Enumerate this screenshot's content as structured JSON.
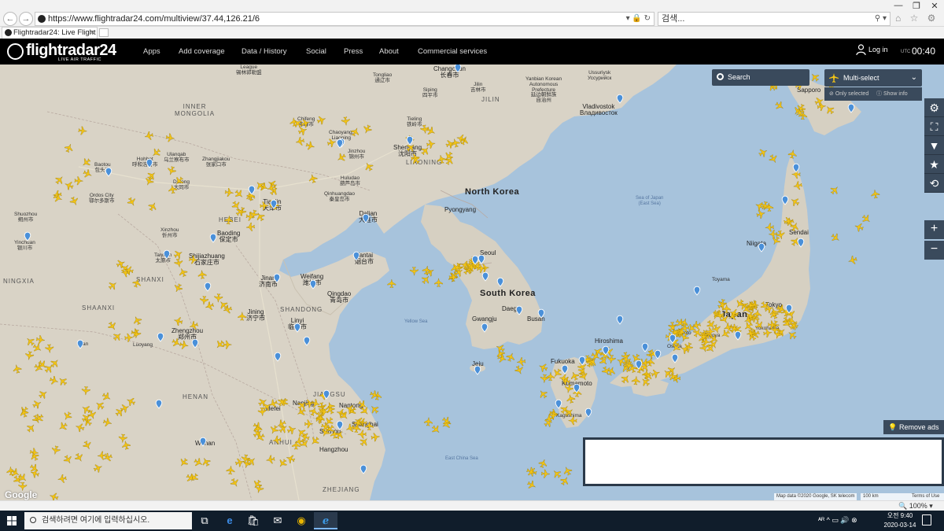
{
  "browser": {
    "url": "https://www.flightradar24.com/multiview/37.44,126.21/6",
    "search_placeholder": "검색...",
    "tab_title": "Flightradar24: Live Flight T...",
    "tab_close": "×",
    "back": "←",
    "forward": "→",
    "addr_tools": "▾ 🔒 ↻",
    "search_icon": "⚲ ▾",
    "toolbar_icons": "⌂ ☆ ⚙ ☺",
    "window_minimize": "—",
    "window_restore": "❐",
    "window_close": "✕"
  },
  "header": {
    "logo": "flightradar24",
    "logo_sub": "LIVE AIR TRAFFIC",
    "menu": [
      "Apps",
      "Add coverage",
      "Data / History",
      "Social",
      "Press",
      "About",
      "Commercial services"
    ],
    "login": "Log in",
    "utc_label": "UTC",
    "utc_time": "00:40"
  },
  "map": {
    "search_label": "Search",
    "multi_select_label": "Multi-select",
    "multi_select_chevron": "⌄",
    "only_selected": "Only selected",
    "show_info": "Show info",
    "side_tools": [
      {
        "name": "settings-icon",
        "glyph": "⚙"
      },
      {
        "name": "fullscreen-icon",
        "glyph": "⛶"
      },
      {
        "name": "filter-icon",
        "glyph": "▼"
      },
      {
        "name": "star-icon",
        "glyph": "★"
      },
      {
        "name": "playback-icon",
        "glyph": "⟲"
      }
    ],
    "zoom_in": "+",
    "zoom_out": "−",
    "remove_ads": "Remove ads",
    "google": "Google",
    "attribution": "Map data ©2020 Google, SK telecom",
    "scale": "100 km",
    "terms": "Terms of Use",
    "countries": {
      "north_korea": "North Korea",
      "south_korea": "South Korea",
      "japan": "Japan"
    },
    "regions": {
      "inner_mongolia": "INNER\nMONGOLIA",
      "jilin": "JILIN",
      "liaoning": "LIAONING",
      "hebei": "HEBEI",
      "shanxi": "SHANXI",
      "shaanxi": "SHAANXI",
      "ningxia": "NINGXIA",
      "shandong": "SHANDONG",
      "henan": "HENAN",
      "jiangsu": "JIANGSU",
      "anhui": "ANHUI",
      "zhejiang": "ZHEJIANG"
    },
    "seas": {
      "yellow_sea": "Yellow Sea",
      "east_china_sea": "East China Sea",
      "sea_of_japan": "Sea of Japan\n(East Sea)"
    },
    "cities": {
      "changchun": "Changchun\n长春市",
      "vladivostok": "Vladivostok\nВладивосток",
      "shenyang": "Shenyang\n沈阳市",
      "pyongyang": "Pyongyang",
      "seoul": "Seoul",
      "daegu": "Daegu",
      "busan": "Busan",
      "gwangju": "Gwangju",
      "jeju": "Jeju",
      "dalian": "Dalian\n大连市",
      "yantai": "Yantai\n烟台市",
      "qingdao": "Qingdao\n青岛市",
      "tianjin": "Tianjin\n天津市",
      "baoding": "Baoding\n保定市",
      "shijiazhuang": "Shijiazhuang\n石家庄市",
      "jinan": "Jinan\n济南市",
      "weifang": "Weifang\n潍坊市",
      "linyi": "Linyi\n临沂市",
      "jining": "Jining\n济宁市",
      "zhengzhou": "Zhengzhou\n郑州市",
      "nanjing": "Nanjing",
      "shanghai": "Shanghai",
      "suzhou": "Suzhou",
      "hangzhou": "Hangzhou",
      "nantong": "Nantong",
      "wuhan": "Wuhan",
      "hefei": "Hefei",
      "datong": "Datong\n大同市",
      "hohhot": "Hohhot\n呼和浩特市",
      "baotou": "Baotou\n包头市",
      "ulanqab": "Ulanqab\n乌兰察布市",
      "zhangjiakou": "Zhangjiakou\n张家口市",
      "chifeng": "Chifeng\n赤峰市",
      "chaoyang": "Chaoyang,\nLiaoning",
      "jinzhou": "Jinzhou\n锦州市",
      "huludao": "Huludao\n葫芦岛市",
      "qinhuangdao": "Qinhuangdao\n秦皇岛市",
      "tieling": "Tieling\n铁岭市",
      "siping": "Siping\n四平市",
      "jilin_city": "Jilin\n吉林市",
      "tongliao": "Tongliao\n通辽市",
      "ordos": "Ordos City\n鄂尔多斯市",
      "shuozhou": "Shuozhou\n朔州市",
      "taiyuan": "Taiyuan\n太原市",
      "xinzhou": "Xinzhou\n忻州市",
      "yinchuan": "Yinchuan\n银川市",
      "luoyang": "Luoyang",
      "xian": "Xi'an",
      "sapporo": "Sapporo",
      "sendai": "Sendai",
      "niigata": "Niigata",
      "tokyo": "Tokyo",
      "yokohama": "Yokohama",
      "nagoya": "Nagoya",
      "osaka": "Osaka",
      "kyoto": "Kyoto",
      "hiroshima": "Hiroshima",
      "fukuoka": "Fukuoka",
      "kumamoto": "Kumamoto",
      "kagoshima": "Kagoshima",
      "toyama": "Toyama",
      "ussuriysk": "Ussuriysk\nУссурийск",
      "yanbian": "Yanbian Korean\nAutonomous\nPrefecture\n延边朝鲜族\n自治州",
      "leshan_mark": "League\n锡林郭勒盟"
    }
  },
  "status": {
    "zoom": "🔍 100%  ▾"
  },
  "taskbar": {
    "search_placeholder": "검색하려면 여기에 입력하십시오.",
    "apps": [
      {
        "name": "task-view-icon",
        "glyph": "⧉"
      },
      {
        "name": "edge-icon",
        "glyph": "e"
      },
      {
        "name": "store-icon",
        "glyph": "🛍"
      },
      {
        "name": "mail-icon",
        "glyph": "✉"
      },
      {
        "name": "chrome-icon",
        "glyph": "◉"
      },
      {
        "name": "ie-icon",
        "glyph": "ℯ"
      }
    ],
    "tray_left": "ᴬᴿ  ^  ▭  🔊  ⊗",
    "time": "오전 9:40",
    "date": "2020-03-14"
  }
}
